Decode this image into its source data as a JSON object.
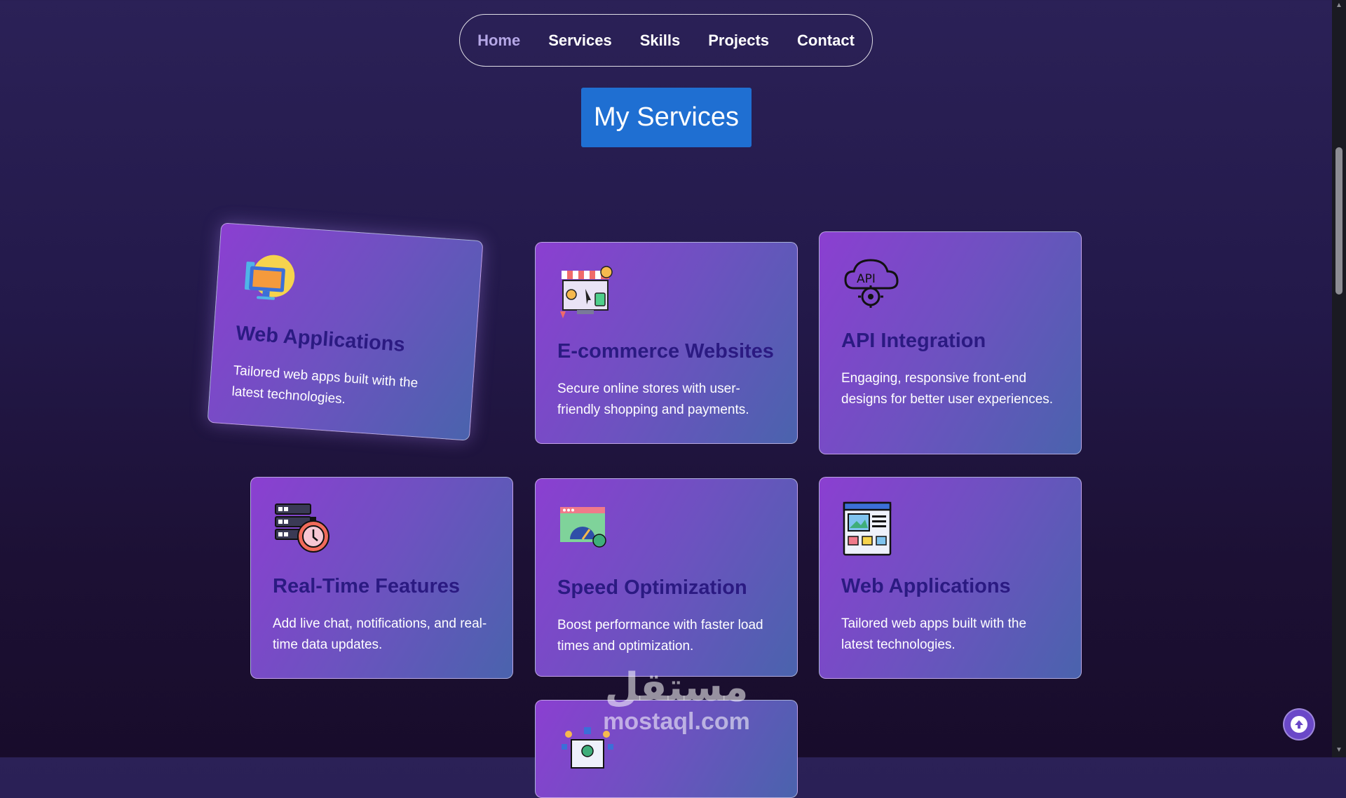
{
  "nav": {
    "items": [
      {
        "label": "Home",
        "active": true
      },
      {
        "label": "Services",
        "active": false
      },
      {
        "label": "Skills",
        "active": false
      },
      {
        "label": "Projects",
        "active": false
      },
      {
        "label": "Contact",
        "active": false
      }
    ]
  },
  "section": {
    "title": "My Services"
  },
  "cards": [
    {
      "title": "Web Applications",
      "desc": "Tailored web apps built with the latest technologies.",
      "icon": "monitor-icon"
    },
    {
      "title": "E-commerce Websites",
      "desc": "Secure online stores with user-friendly shopping and payments.",
      "icon": "storefront-icon"
    },
    {
      "title": "API Integration",
      "desc": "Engaging, responsive front-end designs for better user experiences.",
      "icon": "api-cloud-gear-icon"
    },
    {
      "title": "Real-Time Features",
      "desc": "Add live chat, notifications, and real-time data updates.",
      "icon": "server-stopwatch-icon"
    },
    {
      "title": "Speed Optimization",
      "desc": "Boost performance with faster load times and optimization.",
      "icon": "speedometer-browser-icon"
    },
    {
      "title": "Web Applications",
      "desc": "Tailored web apps built with the latest technologies.",
      "icon": "web-layout-icon"
    },
    {
      "title": "",
      "desc": "",
      "icon": "network-user-icon"
    }
  ],
  "watermark": {
    "arabic": "مستقل",
    "latin": "mostaql.com"
  },
  "colors": {
    "accent_blue": "#1f6fd2",
    "card_title": "#2b1a82",
    "nav_active": "#b5a7e6"
  }
}
